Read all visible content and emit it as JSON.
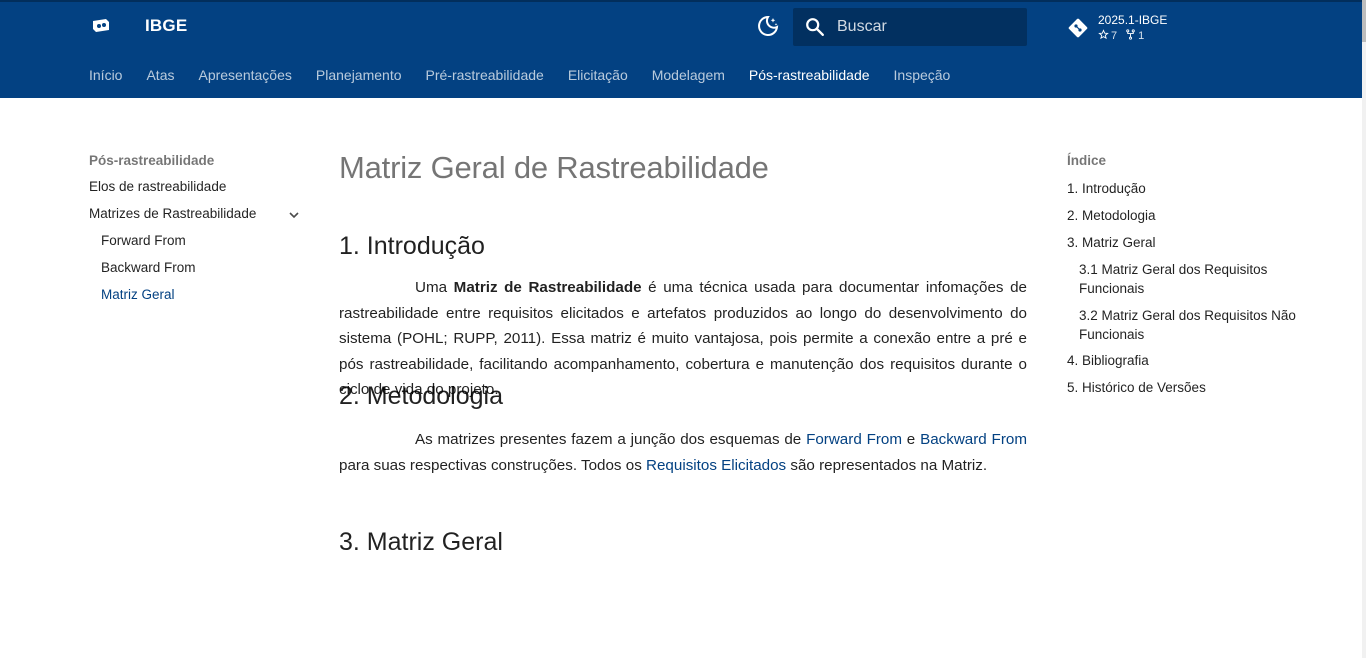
{
  "header": {
    "site_title": "IBGE",
    "search_placeholder": "Buscar",
    "repo": {
      "name": "2025.1-IBGE",
      "stars": "7",
      "forks": "1"
    }
  },
  "tabs": [
    {
      "label": "Início"
    },
    {
      "label": "Atas"
    },
    {
      "label": "Apresentações"
    },
    {
      "label": "Planejamento"
    },
    {
      "label": "Pré-rastreabilidade"
    },
    {
      "label": "Elicitação"
    },
    {
      "label": "Modelagem"
    },
    {
      "label": "Pós-rastreabilidade",
      "active": true
    },
    {
      "label": "Inspeção"
    }
  ],
  "sidebar": {
    "title": "Pós-rastreabilidade",
    "items": [
      {
        "label": "Elos de rastreabilidade"
      },
      {
        "label": "Matrizes de Rastreabilidade"
      },
      {
        "label": "Forward From"
      },
      {
        "label": "Backward From"
      },
      {
        "label": "Matriz Geral"
      }
    ]
  },
  "content": {
    "title": "Matriz Geral de Rastreabilidade",
    "section1": {
      "heading": "1. Introdução",
      "p_start": "Uma ",
      "p_bold": "Matriz de Rastreabilidade",
      "p_rest": " é uma técnica usada para documentar infomações de rastreabilidade entre requisitos elicitados e artefatos produzidos ao longo do desenvolvimento do sistema (POHL; RUPP, 2011). Essa matriz é muito vantajosa, pois permite a conexão entre a pré e pós rastreabilidade, facilitando acompanhamento, cobertura e manutenção dos requisitos durante o ciclo de vida do projeto."
    },
    "section2": {
      "heading": "2. Metodologia",
      "p1": "As matrizes presentes fazem a junção dos esquemas de ",
      "link1": "Forward From",
      "p2": " e ",
      "link2": "Backward From",
      "p3": " para suas respectivas construções. Todos os ",
      "link3": "Requisitos Elicitados",
      "p4": " são representados na Matriz."
    },
    "section3": {
      "heading": "3. Matriz Geral"
    }
  },
  "toc": {
    "title": "Índice",
    "items": [
      {
        "label": "1. Introdução"
      },
      {
        "label": "2. Metodologia"
      },
      {
        "label": "3. Matriz Geral"
      },
      {
        "label": "3.1 Matriz Geral dos Requisitos Funcionais"
      },
      {
        "label": "3.2 Matriz Geral dos Requisitos Não Funcionais"
      },
      {
        "label": "4. Bibliografia"
      },
      {
        "label": "5. Histórico de Versões"
      }
    ]
  },
  "colors": {
    "primary": "#034182",
    "text": "#212121",
    "muted": "#757575"
  }
}
